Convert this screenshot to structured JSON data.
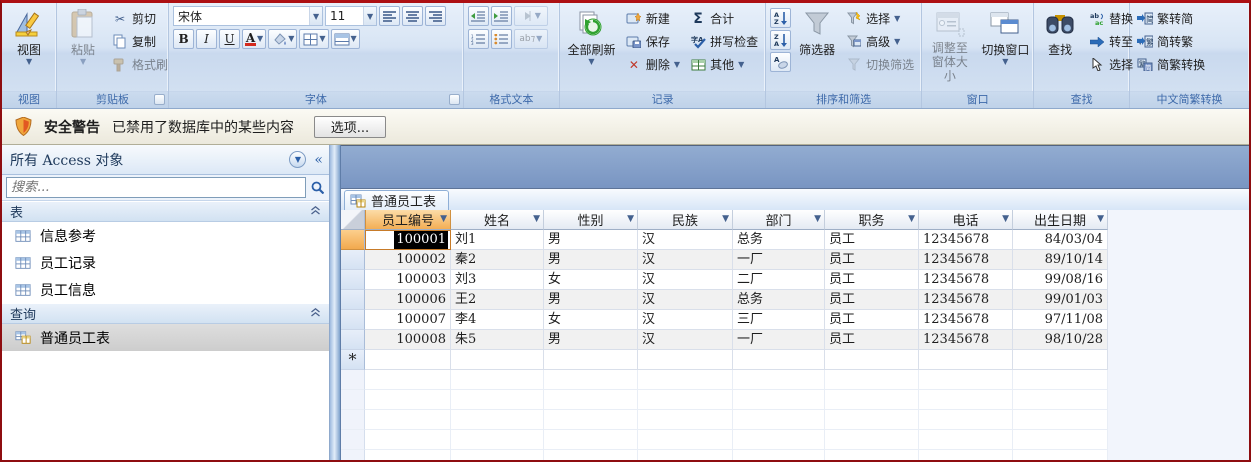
{
  "colors": {
    "window_border": "#8E0D10",
    "ribbon_bg": "#D7E4F4",
    "group_label_text": "#3E6AAA",
    "workspace_blue": "#7E9DC9",
    "selected_header_orange": "#F5B25E",
    "selection_black": "#000000",
    "alt_row_gray": "#F1F1F1",
    "grid_line": "#D9DFEA",
    "nav_selected_gray": "#D4D4D4",
    "font_color_red": "#D42B1E"
  },
  "ribbon": {
    "groups": {
      "views": "视图",
      "clipboard": "剪贴板",
      "font": "字体",
      "richtext": "格式文本",
      "records": "记录",
      "sortfilter": "排序和筛选",
      "window": "窗口",
      "find": "查找",
      "chinese": "中文简繁转换"
    },
    "buttons": {
      "view": "视图",
      "paste": "粘贴",
      "cut": "剪切",
      "copy": "复制",
      "format_painter": "格式刷",
      "bold": "B",
      "italic": "I",
      "underline": "U",
      "font_color": "A",
      "refresh_all": "全部刷新",
      "new": "新建",
      "save": "保存",
      "delete": "删除",
      "totals": "合计",
      "spelling": "拼写检查",
      "more": "其他",
      "filter": "筛选器",
      "selection": "选择",
      "advanced": "高级",
      "toggle_filter": "切换筛选",
      "size_to_fit_line1": "调整至",
      "size_to_fit_line2": "窗体大小",
      "switch_windows": "切换窗口",
      "find": "查找",
      "replace": "替换",
      "goto": "转至",
      "select": "选择",
      "trad_to_simp": "繁转简",
      "simp_to_trad": "简转繁",
      "conversion": "简繁转换"
    },
    "font_name": "宋体",
    "font_size": "11"
  },
  "message_bar": {
    "title": "安全警告",
    "text": "已禁用了数据库中的某些内容",
    "button": "选项..."
  },
  "nav": {
    "title": "所有 Access 对象",
    "collapse_icon": "«",
    "search_placeholder": "搜索...",
    "sections": [
      {
        "label": "表",
        "items": [
          {
            "label": "信息参考",
            "icon": "table-icon",
            "selected": false
          },
          {
            "label": "员工记录",
            "icon": "table-icon",
            "selected": false
          },
          {
            "label": "员工信息",
            "icon": "table-icon",
            "selected": false
          }
        ]
      },
      {
        "label": "查询",
        "items": [
          {
            "label": "普通员工表",
            "icon": "query-icon",
            "selected": true
          }
        ]
      }
    ]
  },
  "doc": {
    "tab_label": "普通员工表"
  },
  "table": {
    "headers": [
      "员工编号",
      "姓名",
      "性别",
      "民族",
      "部门",
      "职务",
      "电话",
      "出生日期"
    ],
    "selected_header": "员工编号",
    "selected_cell": {
      "row": 0,
      "col": 0
    },
    "new_record_marker": "*",
    "rows": [
      [
        "100001",
        "刘1",
        "男",
        "汉",
        "总务",
        "员工",
        "12345678",
        "84/03/04"
      ],
      [
        "100002",
        "秦2",
        "男",
        "汉",
        "一厂",
        "员工",
        "12345678",
        "89/10/14"
      ],
      [
        "100003",
        "刘3",
        "女",
        "汉",
        "二厂",
        "员工",
        "12345678",
        "99/08/16"
      ],
      [
        "100006",
        "王2",
        "男",
        "汉",
        "总务",
        "员工",
        "12345678",
        "99/01/03"
      ],
      [
        "100007",
        "李4",
        "女",
        "汉",
        "三厂",
        "员工",
        "12345678",
        "97/11/08"
      ],
      [
        "100008",
        "朱5",
        "男",
        "汉",
        "一厂",
        "员工",
        "12345678",
        "98/10/28"
      ]
    ]
  }
}
